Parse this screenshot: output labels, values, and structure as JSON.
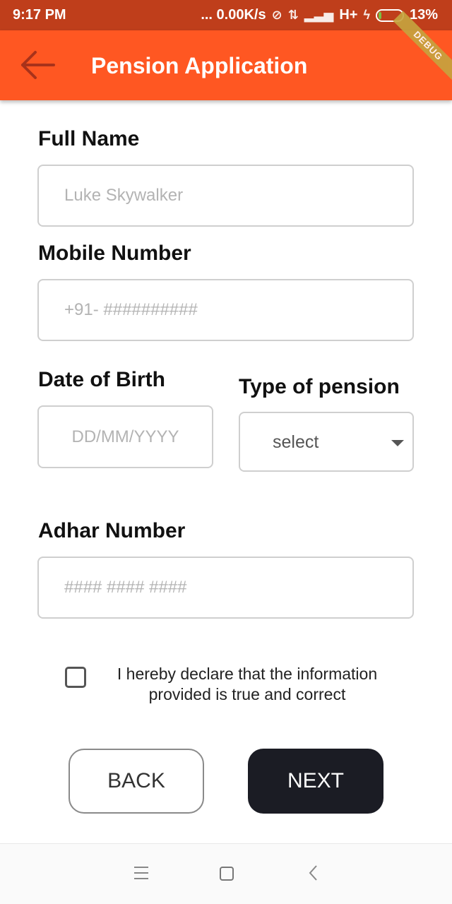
{
  "status_bar": {
    "time": "9:17 PM",
    "net_speed": "... 0.00K/s",
    "network_type": "H+",
    "battery": "13%",
    "battery_level": 0.13
  },
  "app_bar": {
    "title": "Pension Application",
    "debug_label": "DEBUG"
  },
  "form": {
    "full_name": {
      "label": "Full Name",
      "placeholder": "Luke Skywalker"
    },
    "mobile": {
      "label": "Mobile Number",
      "placeholder": "+91- ##########"
    },
    "dob": {
      "label": "Date of Birth",
      "placeholder": "DD/MM/YYYY"
    },
    "pension_type": {
      "label": "Type of pension",
      "value": "select"
    },
    "adhar": {
      "label": "Adhar Number",
      "placeholder": "#### #### ####"
    },
    "declaration": "I hereby declare that the information provided is true and correct"
  },
  "buttons": {
    "back": "BACK",
    "next": "NEXT"
  },
  "colors": {
    "status_bar": "#bf3e1b",
    "app_bar": "#ff5722",
    "next_button": "#1b1c24",
    "battery_fill": "#7bc043"
  }
}
